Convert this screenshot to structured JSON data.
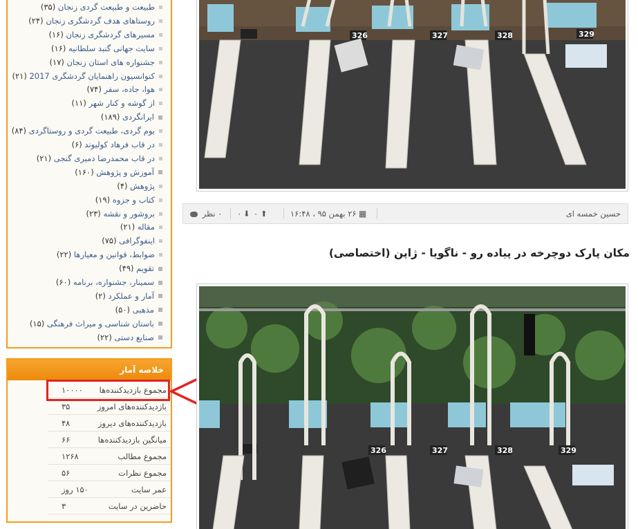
{
  "sidebar": {
    "categories": [
      {
        "label": "طبیعت و طبیعت گردی زنجان",
        "count": "(۳۵)",
        "sub": true
      },
      {
        "label": "روستاهای هدف گردشگری زنجان",
        "count": "(۲۴)",
        "sub": true
      },
      {
        "label": "مسیرهای گردشگری زنجان",
        "count": "(۱۶)",
        "sub": true
      },
      {
        "label": "سایت جهانی گنبد سلطانیه",
        "count": "(۱۶)",
        "sub": true
      },
      {
        "label": "جشنواره های استان زنجان",
        "count": "(۱۷)",
        "sub": true
      },
      {
        "label": "کنوانسیون راهنمایان گردشگری 2017",
        "count": "(۲۱)",
        "sub": true
      },
      {
        "label": "هوا، جاده، سفر",
        "count": "(۷۴)",
        "sub": true
      },
      {
        "label": "از گوشه و کنار شهر",
        "count": "(۱۱)",
        "sub": true
      },
      {
        "label": "ایرانگردی",
        "count": "(۱۸۹)",
        "sub": false
      },
      {
        "label": "بوم گردی، طبیعت گردی و روستاگردی",
        "count": "(۸۴)",
        "sub": true
      },
      {
        "label": "در قاب فرهاد کولیوند",
        "count": "(۶)",
        "sub": true
      },
      {
        "label": "در قاب محمدرضا دمیری گنجی",
        "count": "(۲۱)",
        "sub": true
      },
      {
        "label": "آموزش و پژوهش",
        "count": "(۱۶۰)",
        "sub": false
      },
      {
        "label": "پژوهش",
        "count": "(۴)",
        "sub": true
      },
      {
        "label": "کتاب و جزوه",
        "count": "(۱۹)",
        "sub": true
      },
      {
        "label": "بروشور و نقشه",
        "count": "(۲۳)",
        "sub": true
      },
      {
        "label": "مقاله",
        "count": "(۲۱)",
        "sub": true
      },
      {
        "label": "اینفوگرافی",
        "count": "(۷۵)",
        "sub": true
      },
      {
        "label": "ضوابط، قوانین و معیارها",
        "count": "(۲۲)",
        "sub": true
      },
      {
        "label": "تقویم",
        "count": "(۴۹)",
        "sub": false
      },
      {
        "label": "سمینار، جشنواره، برنامه",
        "count": "(۶۰)",
        "sub": false
      },
      {
        "label": "آمار و عملکرد",
        "count": "(۲)",
        "sub": false
      },
      {
        "label": "مذهبی",
        "count": "(۵۰)",
        "sub": false
      },
      {
        "label": "باستان شناسی و میراث فرهنگی",
        "count": "(۱۵)",
        "sub": false
      },
      {
        "label": "صنایع دستی",
        "count": "(۲۲)",
        "sub": false
      }
    ],
    "stats": {
      "title": "خلاصه آمار",
      "rows": [
        {
          "label": "مجموع بازدیدکننده‌ها",
          "value": "۱۰۰۰۰"
        },
        {
          "label": "بازدیدکننده‌های امروز",
          "value": "۳۵"
        },
        {
          "label": "بازدیدکننده‌های دیروز",
          "value": "۴۸"
        },
        {
          "label": "میانگین بازدیدکننده‌ها",
          "value": "۶۶"
        },
        {
          "label": "مجموع مطالب",
          "value": "۱۲۶۸"
        },
        {
          "label": "مجموع نظرات",
          "value": "۵۶"
        },
        {
          "label": "عمر سایت",
          "value": "۱۵۰ روز"
        },
        {
          "label": "حاضرین در سایت",
          "value": "۳"
        }
      ]
    }
  },
  "post_meta": {
    "author": "حسین خمسه ای",
    "date": "۲۶ بهمن ۹۵ ، ۱۶:۴۸",
    "up_votes": "۰",
    "down_votes": "۰",
    "comments": "۰ نظر"
  },
  "post": {
    "title": "مکان پارک دوچرخه در پیاده رو - ناگویا - ژاپن (اختصاصی)"
  },
  "photo_labels": {
    "top": [
      "326",
      "327",
      "328",
      "329"
    ],
    "bottom": [
      "326",
      "327",
      "328",
      "329"
    ]
  },
  "colors": {
    "accent": "#f39c1d",
    "link": "#3a5a8c",
    "highlight": "#e32320"
  }
}
